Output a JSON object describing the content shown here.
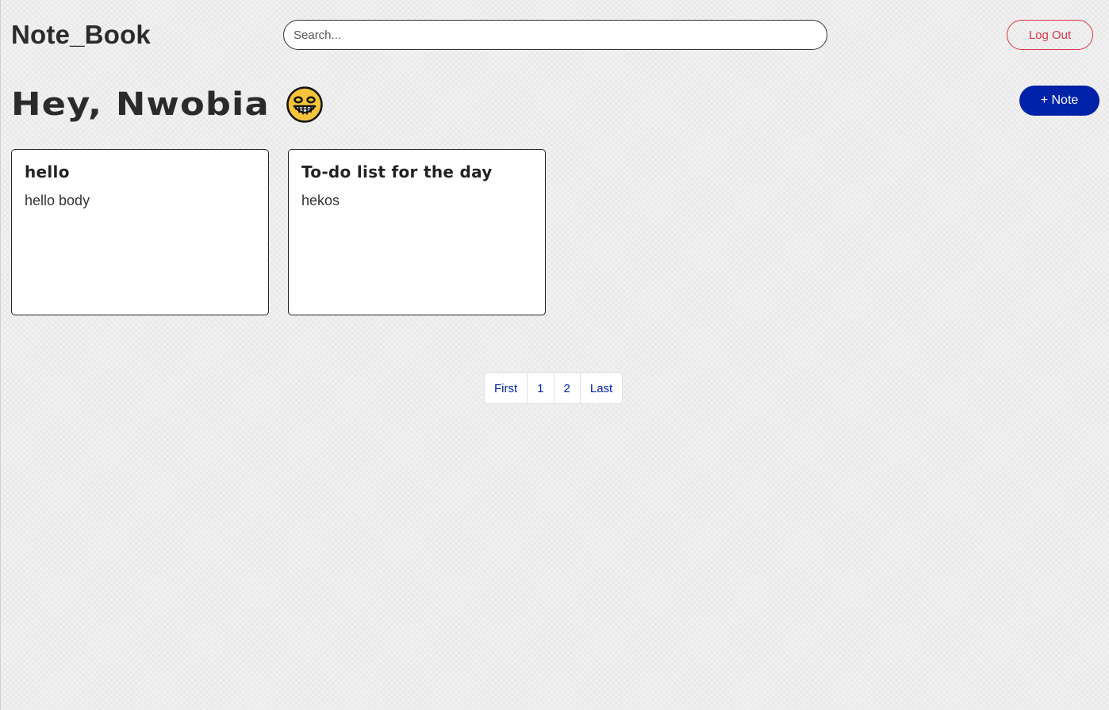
{
  "navbar": {
    "brand": "Note_Book",
    "search_placeholder": "Search...",
    "logout_label": "Log Out"
  },
  "header": {
    "greeting": "Hey, Nwobia",
    "emoji_icon": "grinning-face-icon",
    "add_note_label": "+ Note"
  },
  "notes": [
    {
      "title": "hello",
      "body": "hello body"
    },
    {
      "title": "To-do list for the day",
      "body": "hekos"
    }
  ],
  "pagination": {
    "items": [
      "First",
      "1",
      "2",
      "Last"
    ]
  },
  "colors": {
    "accent": "#0022a8",
    "danger": "#dc3545",
    "emoji_fill": "#f5c33b"
  }
}
